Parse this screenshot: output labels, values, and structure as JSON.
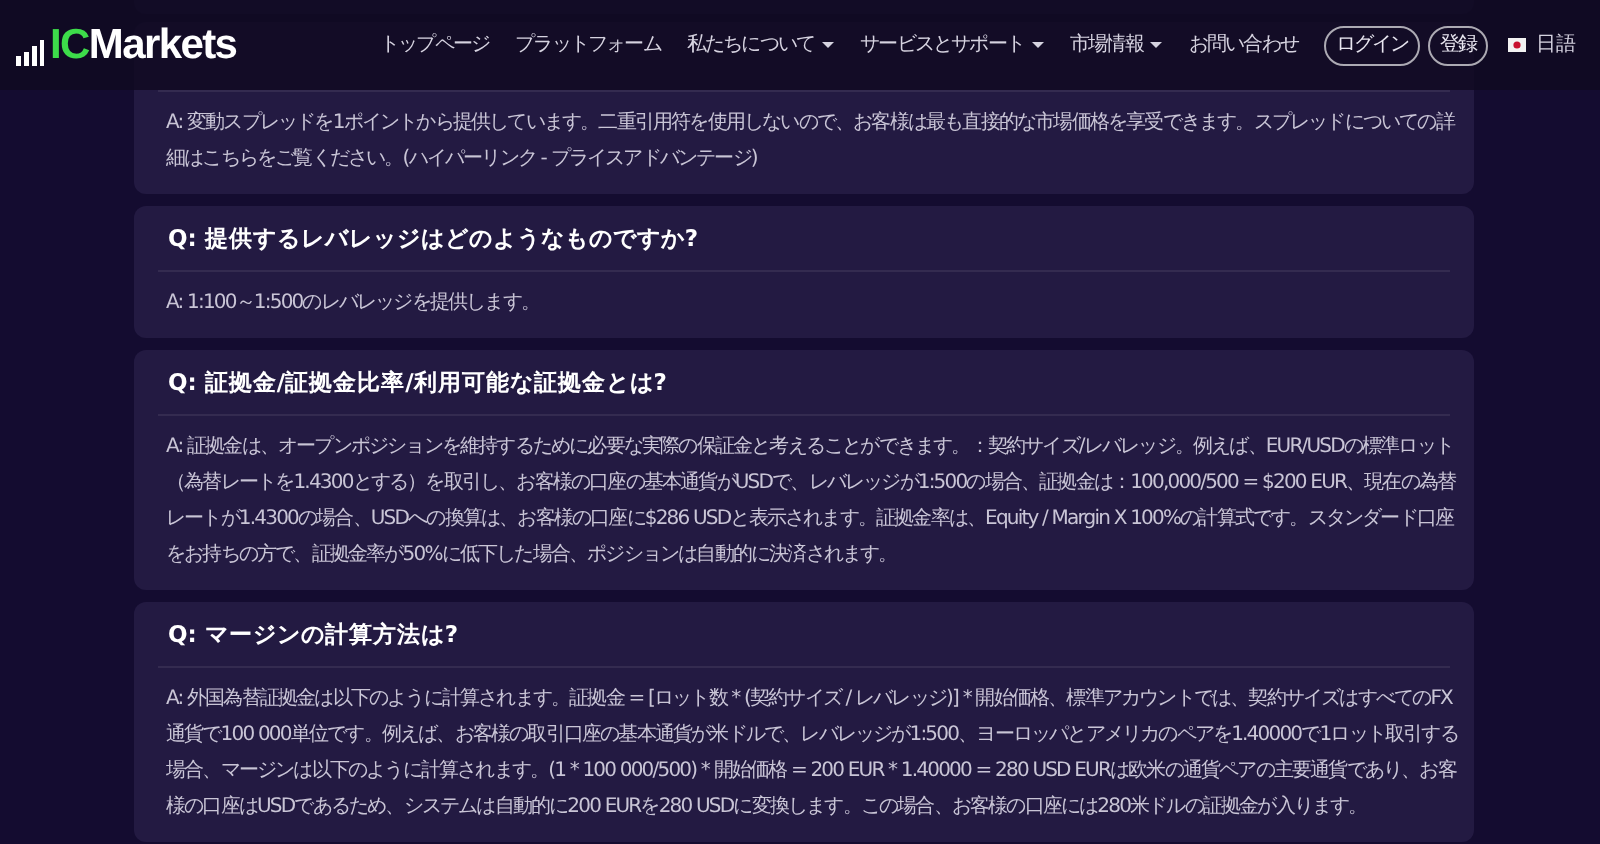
{
  "navbar": {
    "logo": {
      "prefix": "IC",
      "name": "Markets"
    },
    "items": [
      {
        "label": "トップページ",
        "dropdown": false
      },
      {
        "label": "プラットフォーム",
        "dropdown": false
      },
      {
        "label": "私たちについて",
        "dropdown": true
      },
      {
        "label": "サービスとサポート",
        "dropdown": true
      },
      {
        "label": "市場情報",
        "dropdown": true
      },
      {
        "label": "お問い合わせ",
        "dropdown": false
      }
    ],
    "buttons": [
      "ログイン",
      "登録"
    ],
    "language": "日語"
  },
  "faq": [
    {
      "answer": "A: 変動スプレッドを1ポイントから提供しています。二重引用符を使用しないので、お客様は最も直接的な市場価格を享受できます。スプレッドについての詳細はこちらをご覧ください。(ハイパーリンク - プライスアドバンテージ)"
    },
    {
      "question": "Q: 提供するレバレッジはどのようなものですか?",
      "answer": "A: 1:100～1:500のレバレッジを提供します。"
    },
    {
      "question": "Q: 証拠金/証拠金比率/利用可能な証拠金とは?",
      "answer": "A: 証拠金は、オープンポジションを維持するために必要な実際の保証金と考えることができます。：契約サイズ/レバレッジ。例えば、EUR/USDの標準ロット（為替レートを1.4300とする）を取引し、お客様の口座の基本通貨がUSDで、レバレッジが1:500の場合、証拠金は：100,000/500 = $200 EUR、現在の為替レートが1.4300の場合、USDへの換算は、お客様の口座に$286 USDと表示されます。証拠金率は、Equity / Margin X 100%の計算式です。スタンダード口座をお持ちの方で、証拠金率が50%に低下した場合、ポジションは自動的に決済されます。"
    },
    {
      "question": "Q: マージンの計算方法は?",
      "answer": "A: 外国為替証拠金は以下のように計算されます。証拠金 = [ロット数 * (契約サイズ / レバレッジ)] * 開始価格、標準アカウントでは、契約サイズはすべてのFX通貨で100 000単位です。例えば、お客様の取引口座の基本通貨が米ドルで、レバレッジが1:500、ヨーロッパとアメリカのペアを1.40000で1ロット取引する場合、マージンは以下のように計算されます。(1 * 100 000/500) * 開始価格 = 200 EUR * 1.40000 = 280 USD EURは欧米の通貨ペアの主要通貨であり、お客様の口座はUSDであるため、システムは自動的に200 EURを280 USDに変換します。この場合、お客様の口座には280米ドルの証拠金が入ります。"
    }
  ]
}
